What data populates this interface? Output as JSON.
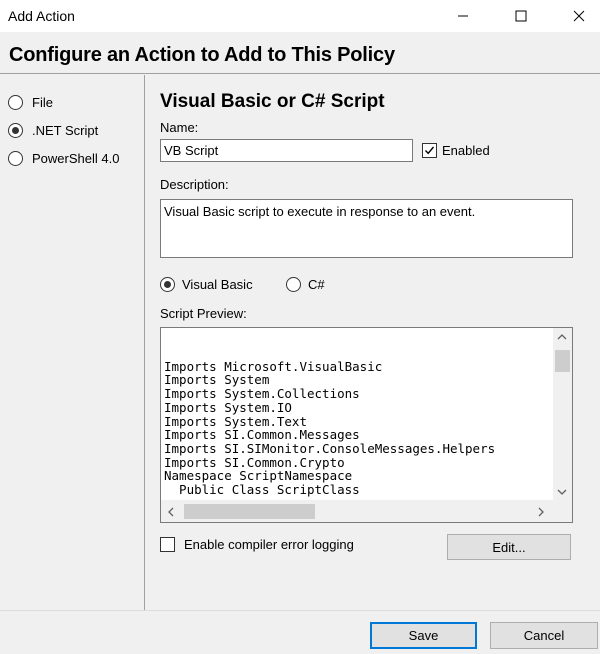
{
  "window": {
    "title": "Add Action"
  },
  "header": {
    "title": "Configure an Action to Add to This Policy"
  },
  "action_types": [
    {
      "label": "File",
      "selected": false
    },
    {
      "label": ".NET Script",
      "selected": true
    },
    {
      "label": "PowerShell 4.0",
      "selected": false
    }
  ],
  "form": {
    "section_title": "Visual Basic or C# Script",
    "name_label": "Name:",
    "name_value": "VB Script",
    "enabled_label": "Enabled",
    "enabled_checked": true,
    "description_label": "Description:",
    "description_value": "Visual Basic script to execute in response to an event.",
    "languages": [
      {
        "label": "Visual Basic",
        "selected": true
      },
      {
        "label": "C#",
        "selected": false
      }
    ],
    "script_preview_label": "Script Preview:",
    "script_lines": [
      "Imports Microsoft.VisualBasic",
      "Imports System",
      "Imports System.Collections",
      "Imports System.IO",
      "Imports System.Text",
      "Imports SI.Common.Messages",
      "Imports SI.SIMonitor.ConsoleMessages.Helpers",
      "Imports SI.Common.Crypto",
      "",
      "Namespace ScriptNamespace",
      "",
      "  Public Class ScriptClass"
    ],
    "compiler_logging_label": "Enable compiler error logging",
    "compiler_logging_checked": false,
    "edit_label": "Edit..."
  },
  "footer": {
    "save_label": "Save",
    "cancel_label": "Cancel"
  },
  "colors": {
    "default_button_border": "#0078d7",
    "window_background": "#f0f0f0"
  },
  "icons": {
    "minimize": "minimize-icon",
    "maximize": "maximize-icon",
    "close": "close-icon"
  }
}
